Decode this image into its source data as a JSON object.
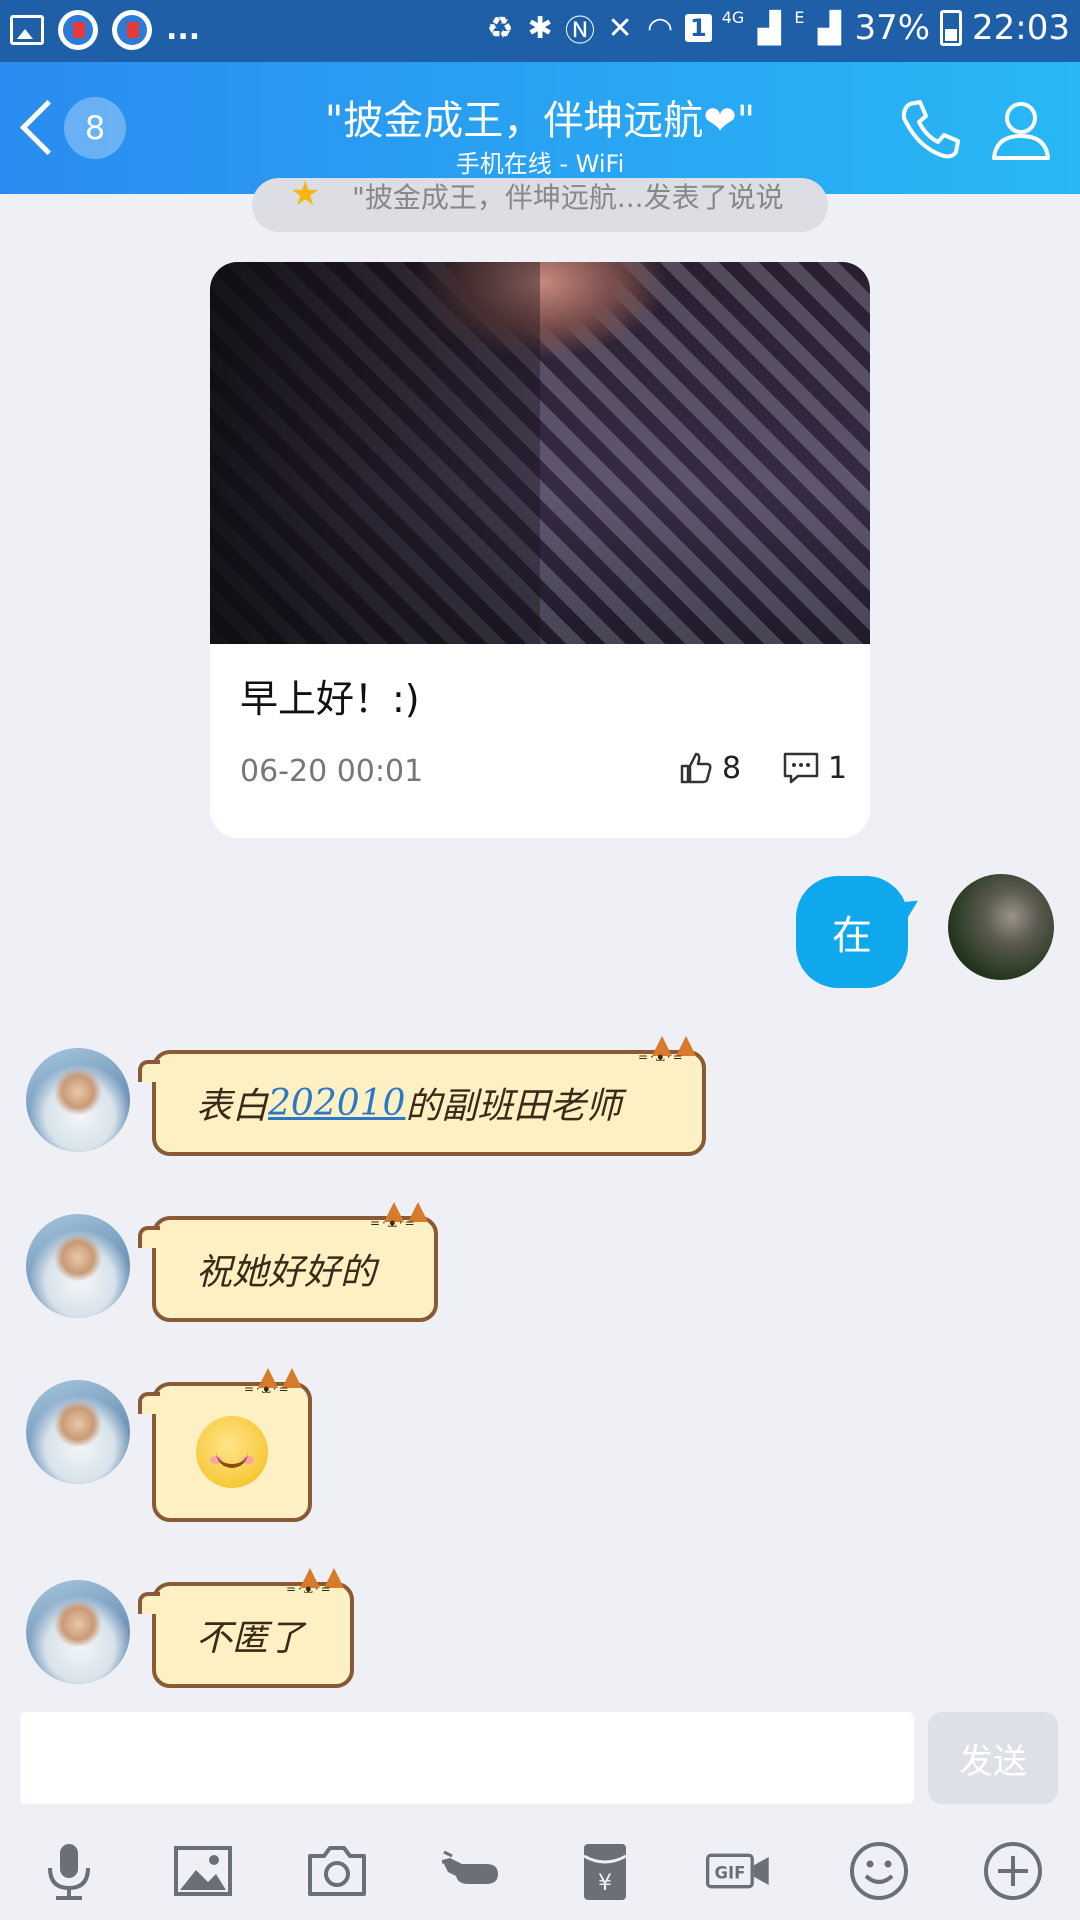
{
  "status_bar": {
    "left_more": "...",
    "network_4g": "4G",
    "network_e": "E",
    "sim_badge": "1",
    "battery": "37%",
    "time": "22:03"
  },
  "header": {
    "unread_count": "8",
    "title": "\"披金成王，伴坤远航❤\"",
    "subtitle": "手机在线 - WiFi"
  },
  "pinned_notice": "\"披金成王，伴坤远航...发表了说说",
  "post_card": {
    "caption": "早上好！:)",
    "time": "06-20 00:01",
    "likes": "8",
    "comments": "1"
  },
  "messages": [
    {
      "from": "me",
      "text": "在"
    },
    {
      "from": "them",
      "prefix": "表白",
      "link": "202010",
      "suffix": "的副班田老师"
    },
    {
      "from": "them",
      "text": "祝她好好的"
    },
    {
      "from": "them",
      "emoji": "smile"
    },
    {
      "from": "them",
      "text": "不匿了"
    }
  ],
  "input": {
    "value": "",
    "placeholder": ""
  },
  "send_label": "发送",
  "toolbar_icons": [
    "mic-icon",
    "image-icon",
    "camera-icon",
    "poke-icon",
    "red-packet-icon",
    "gif-icon",
    "emoji-icon",
    "plus-icon"
  ],
  "colors": {
    "header_start": "#2a8cf0",
    "header_end": "#28b8f5",
    "own_bubble": "#10a8ec",
    "status_bar": "#1f5fa8",
    "cat_bubble": "#fdf0c2"
  }
}
